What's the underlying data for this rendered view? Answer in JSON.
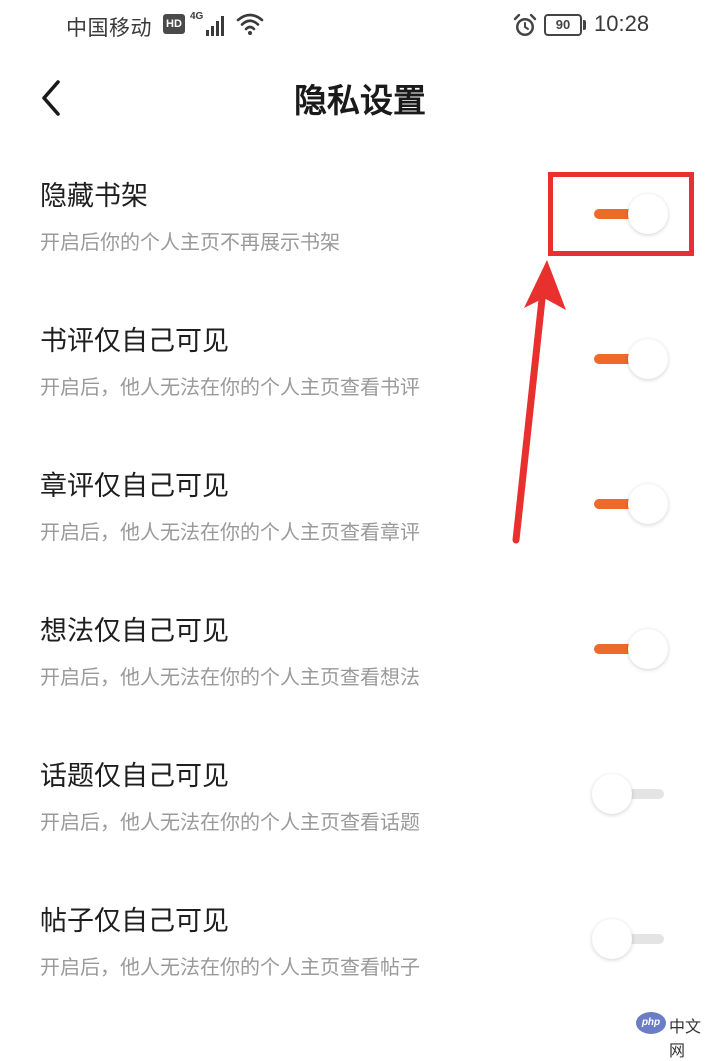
{
  "status_bar": {
    "carrier": "中国移动",
    "hd_badge": "HD",
    "network_type": "4G",
    "battery_level": "90",
    "time": "10:28"
  },
  "header": {
    "title": "隐私设置",
    "back_icon": "chevron-left-icon"
  },
  "settings": [
    {
      "title": "隐藏书架",
      "description": "开启后你的个人主页不再展示书架",
      "enabled": true
    },
    {
      "title": "书评仅自己可见",
      "description": "开启后，他人无法在你的个人主页查看书评",
      "enabled": true
    },
    {
      "title": "章评仅自己可见",
      "description": "开启后，他人无法在你的个人主页查看章评",
      "enabled": true
    },
    {
      "title": "想法仅自己可见",
      "description": "开启后，他人无法在你的个人主页查看想法",
      "enabled": true
    },
    {
      "title": "话题仅自己可见",
      "description": "开启后，他人无法在你的个人主页查看话题",
      "enabled": false
    },
    {
      "title": "帖子仅自己可见",
      "description": "开启后，他人无法在你的个人主页查看帖子",
      "enabled": false
    }
  ],
  "colors": {
    "toggle_on": "#ee6a2a",
    "toggle_off": "#e4e4e4",
    "annotation": "#e8312e"
  },
  "watermark": {
    "logo": "php",
    "text": "中文网"
  }
}
